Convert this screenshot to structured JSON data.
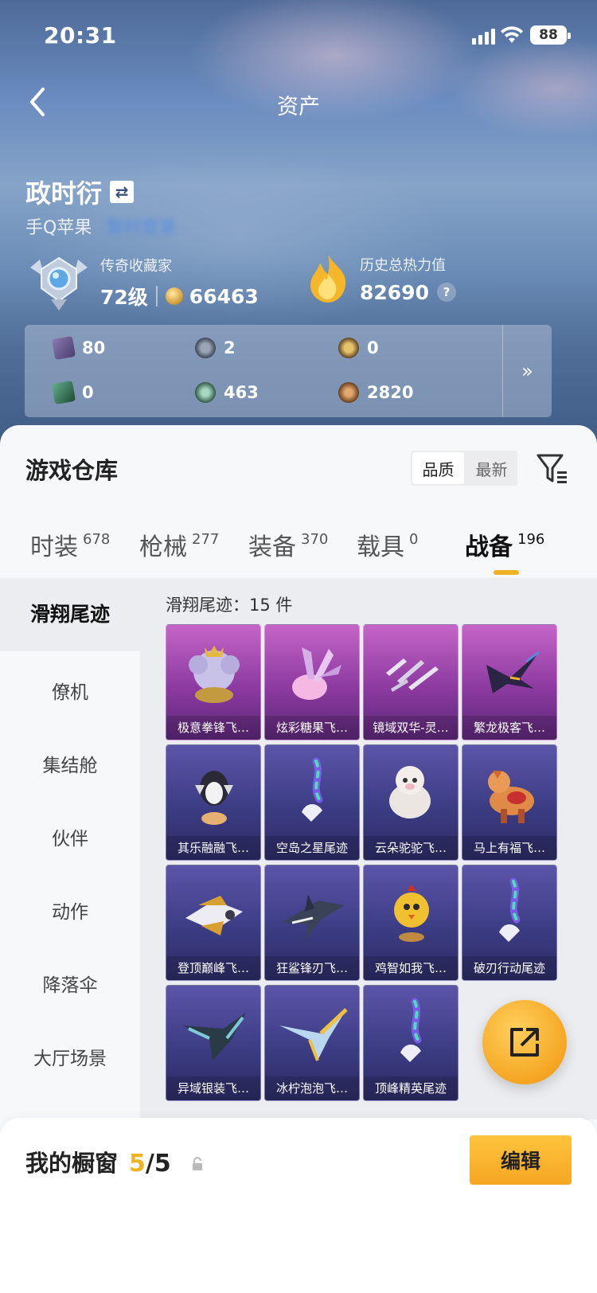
{
  "status_bar": {
    "time": "20:31",
    "battery": "88"
  },
  "nav": {
    "title": "资产"
  },
  "profile": {
    "name": "政时衍",
    "platform": "手Q苹果",
    "platform_link": "暂时登录",
    "rank_label": "传奇收藏家",
    "level": "72级",
    "coins": "66463",
    "heat_label": "历史总热力值",
    "heat_value": "82690",
    "help": "?"
  },
  "stats": [
    {
      "icon": "card-icon",
      "value": "80",
      "color": "#6a5a8e"
    },
    {
      "icon": "s-coin-icon",
      "value": "2",
      "color": "#4c5563"
    },
    {
      "icon": "gold-medal-icon",
      "value": "0",
      "color": "#8a6a2e"
    },
    {
      "icon": "green-card-icon",
      "value": "0",
      "color": "#2f6a4a"
    },
    {
      "icon": "green-coin-icon",
      "value": "463",
      "color": "#3c6a58"
    },
    {
      "icon": "bronze-coin-icon",
      "value": "2820",
      "color": "#8a5a30"
    }
  ],
  "stats_more": "»",
  "warehouse": {
    "title": "游戏仓库",
    "sort_options": [
      "品质",
      "最新"
    ],
    "tabs": [
      {
        "label": "时装",
        "count": "678"
      },
      {
        "label": "枪械",
        "count": "277"
      },
      {
        "label": "装备",
        "count": "370"
      },
      {
        "label": "载具",
        "count": "0"
      },
      {
        "label": "战备",
        "count": "196"
      }
    ],
    "sidebar": [
      "滑翔尾迹",
      "僚机",
      "集结舱",
      "伙伴",
      "动作",
      "降落伞",
      "大厅场景"
    ],
    "count_text": "滑翔尾迹：15 件",
    "items": [
      {
        "label": "极意拳锋飞…",
        "tier": "purple",
        "art": "elephant-glider-icon"
      },
      {
        "label": "炫彩糖果飞…",
        "tier": "purple",
        "art": "candy-glider-icon"
      },
      {
        "label": "镜域双华-灵…",
        "tier": "purple",
        "art": "crystal-glider-icon"
      },
      {
        "label": "繁龙极客飞…",
        "tier": "purple",
        "art": "dragon-glider-icon"
      },
      {
        "label": "其乐融融飞…",
        "tier": "blue",
        "art": "penguin-glider-icon"
      },
      {
        "label": "空岛之星尾迹",
        "tier": "blue",
        "art": "rainbow-trail-icon"
      },
      {
        "label": "云朵驼驼飞…",
        "tier": "blue",
        "art": "alpaca-glider-icon"
      },
      {
        "label": "马上有福飞…",
        "tier": "blue",
        "art": "horse-glider-icon"
      },
      {
        "label": "登顶巅峰飞…",
        "tier": "blue",
        "art": "jet-glider-icon"
      },
      {
        "label": "狂鲨锋刃飞…",
        "tier": "blue",
        "art": "shark-glider-icon"
      },
      {
        "label": "鸡智如我飞…",
        "tier": "blue",
        "art": "chicken-glider-icon"
      },
      {
        "label": "破刃行动尾迹",
        "tier": "blue",
        "art": "rainbow-trail-icon"
      },
      {
        "label": "异域银装飞…",
        "tier": "blue",
        "art": "wing-glider-icon"
      },
      {
        "label": "冰柠泡泡飞…",
        "tier": "blue",
        "art": "plane-glider-icon"
      },
      {
        "label": "顶峰精英尾迹",
        "tier": "blue",
        "art": "rainbow-trail-icon"
      }
    ]
  },
  "showcase": {
    "title": "我的橱窗",
    "current": "5",
    "total": "/5",
    "edit_label": "编辑"
  }
}
